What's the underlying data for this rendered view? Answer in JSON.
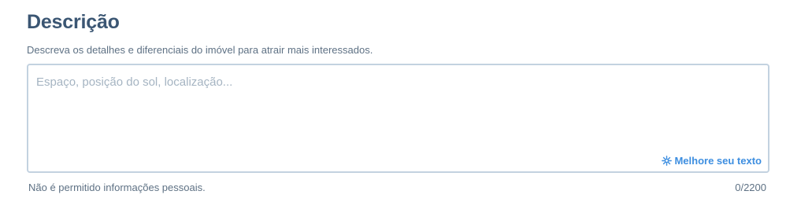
{
  "section": {
    "title": "Descrição",
    "subtitle": "Descreva os detalhes e diferenciais do imóvel para atrair mais interessados."
  },
  "description_field": {
    "value": "",
    "placeholder": "Espaço, posição do sol, localização...",
    "improve_button_label": "Melhore seu texto",
    "improve_button_icon": "sparkle-icon",
    "helper_text": "Não é permitido informações pessoais.",
    "counter": "0/2200"
  },
  "colors": {
    "title": "#3b5673",
    "muted_text": "#5e7184",
    "border": "#c3d2e0",
    "placeholder": "#a5b4c2",
    "accent": "#3d8ee0"
  }
}
